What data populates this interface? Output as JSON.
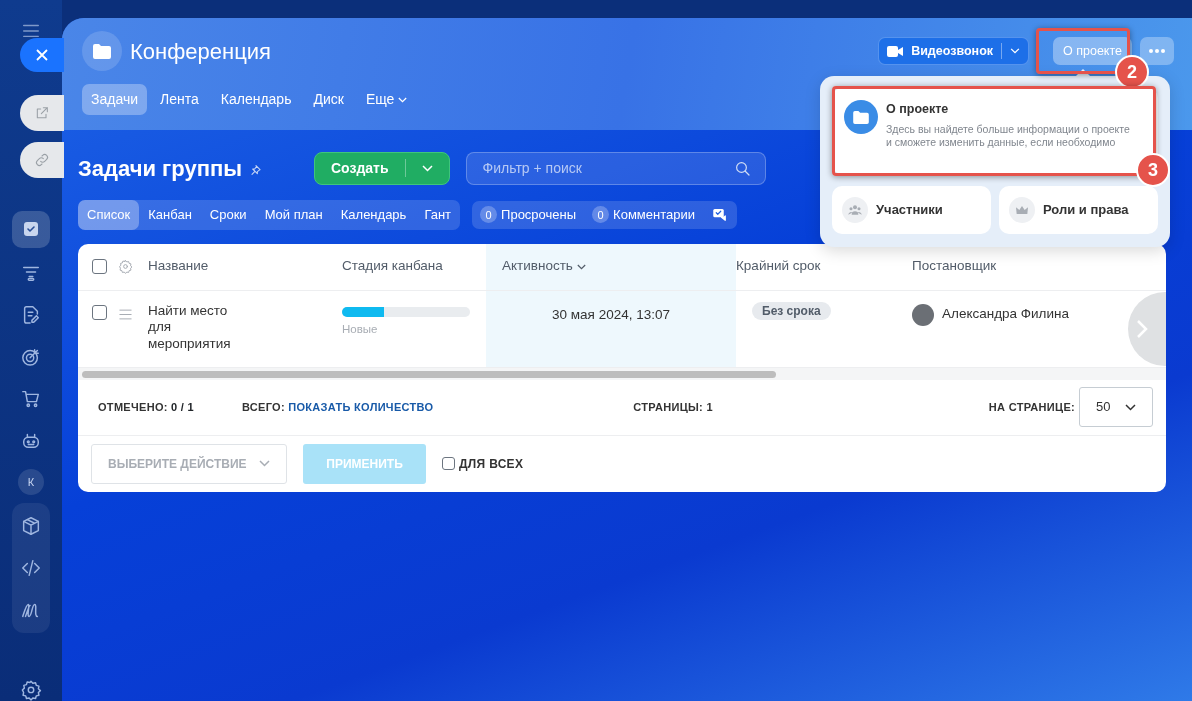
{
  "sidebar": {
    "avatar": "К"
  },
  "header": {
    "title": "Конференция",
    "tabs": [
      {
        "label": "Задачи",
        "selected": true
      },
      {
        "label": "Лента",
        "selected": false
      },
      {
        "label": "Календарь",
        "selected": false
      },
      {
        "label": "Диск",
        "selected": false
      }
    ],
    "more_tab": "Еще",
    "video_button": "Видеозвонок",
    "about_button": "О проекте"
  },
  "popup": {
    "main": {
      "title": "О проекте",
      "description": "Здесь вы найдете больше информации о проекте и сможете изменить данные, если необходимо"
    },
    "items": [
      {
        "kind": "people",
        "label": "Участники"
      },
      {
        "kind": "crown",
        "label": "Роли и права"
      }
    ]
  },
  "annotations": [
    {
      "number": "2"
    },
    {
      "number": "3"
    }
  ],
  "toolbar": {
    "title": "Задачи группы",
    "create_button": "Создать",
    "search": {
      "placeholder": "Фильтр + поиск"
    }
  },
  "view_tabs": [
    {
      "label": "Список",
      "selected": true
    },
    {
      "label": "Канбан",
      "selected": false
    },
    {
      "label": "Сроки",
      "selected": false
    },
    {
      "label": "Мой план",
      "selected": false
    },
    {
      "label": "Календарь",
      "selected": false
    },
    {
      "label": "Гант",
      "selected": false
    }
  ],
  "counters": [
    {
      "count": "0",
      "label": "Просрочены"
    },
    {
      "count": "0",
      "label": "Комментарии"
    }
  ],
  "table": {
    "all_checked": false,
    "columns": [
      {
        "label": "Название",
        "sorted": false
      },
      {
        "label": "Стадия канбана",
        "sorted": false
      },
      {
        "label": "Активность",
        "sorted": true
      },
      {
        "label": "Крайний срок",
        "sorted": false
      },
      {
        "label": "Постановщик",
        "sorted": false
      }
    ],
    "rows": [
      {
        "checked": false,
        "title": "Найти место для мероприятия",
        "stage": {
          "level": 0.33,
          "label": "Новые"
        },
        "activity": "30 мая 2024, 13:07",
        "deadline": "Без срока",
        "creator": "Александра Филина"
      }
    ]
  },
  "footer": {
    "selected_label": "ОТМЕЧЕНО:",
    "selected_value": "0 / 1",
    "total_label": "ВСЕГО:",
    "total_link": "ПОКАЗАТЬ КОЛИЧЕСТВО",
    "pages_label": "СТРАНИЦЫ:",
    "pages_value": "1",
    "per_page_label": "НА СТРАНИЦЕ:",
    "per_page_value": "50"
  },
  "actions": {
    "select_placeholder": "ВЫБЕРИТЕ ДЕЙСТВИЕ",
    "apply_button": {
      "label": "ПРИМЕНИТЬ",
      "disabled": true
    },
    "for_all": {
      "label": "ДЛЯ ВСЕХ",
      "checked": false
    }
  }
}
